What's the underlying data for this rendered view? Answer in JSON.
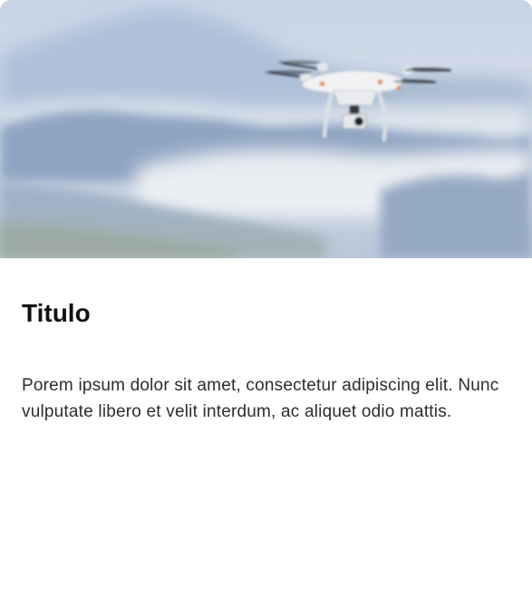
{
  "card": {
    "image_subject": "drone-over-misty-mountains",
    "title": "Titulo",
    "description": "Porem ipsum dolor sit amet, consectetur adipiscing elit. Nunc vulputate libero et velit interdum, ac aliquet odio mattis."
  },
  "colors": {
    "background": "#ffffff",
    "title": "#111111",
    "text": "#2d2d2d",
    "sky": "#c9d6e8",
    "mountain": "#8ea6c6",
    "mist": "#e8edf2"
  }
}
